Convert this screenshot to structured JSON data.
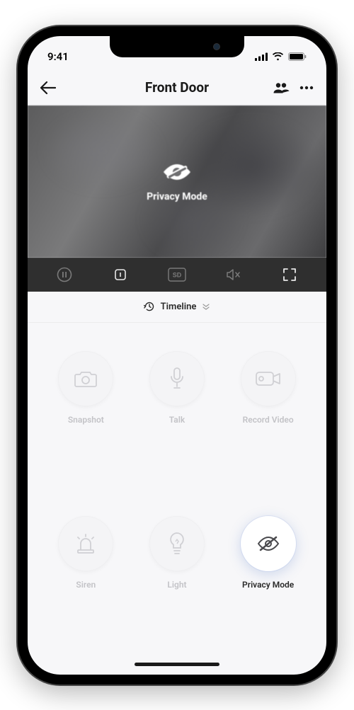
{
  "status": {
    "time": "9:41"
  },
  "nav": {
    "title": "Front Door"
  },
  "video": {
    "overlay_label": "Privacy Mode"
  },
  "toolbar": {
    "quality_label": "SD"
  },
  "timeline": {
    "label": "Timeline"
  },
  "actions": [
    {
      "label": "Snapshot",
      "active": false
    },
    {
      "label": "Talk",
      "active": false
    },
    {
      "label": "Record Video",
      "active": false
    },
    {
      "label": "Siren",
      "active": false
    },
    {
      "label": "Light",
      "active": false
    },
    {
      "label": "Privacy Mode",
      "active": true
    }
  ]
}
